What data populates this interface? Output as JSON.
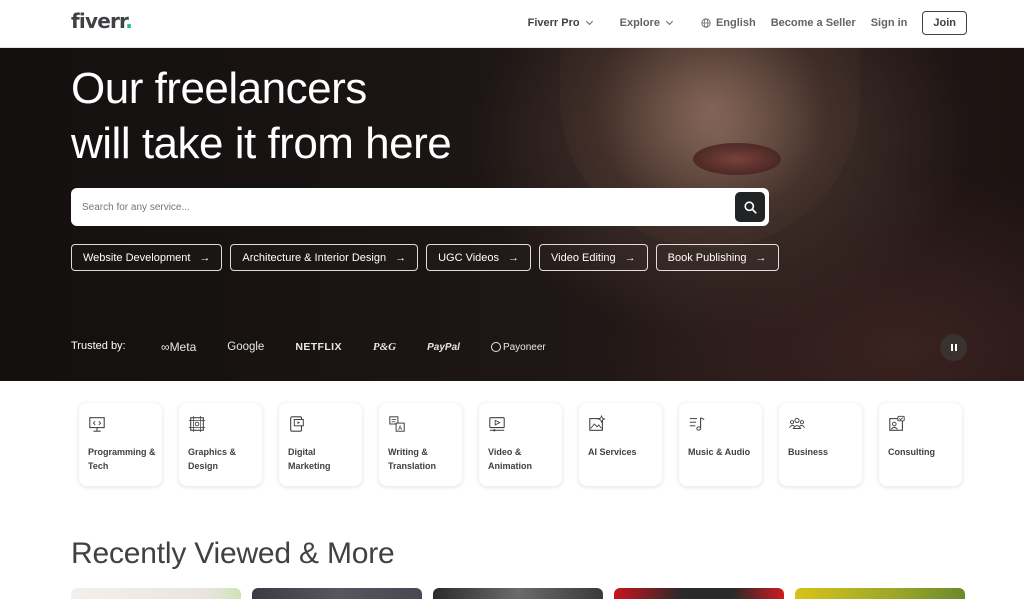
{
  "header": {
    "logo": "fiverr",
    "logo_dot": ".",
    "nav": {
      "fiverr_pro": "Fiverr Pro",
      "explore": "Explore",
      "language": "English",
      "become_seller": "Become a Seller",
      "sign_in": "Sign in",
      "join": "Join"
    }
  },
  "hero": {
    "title_line1": "Our freelancers",
    "title_line2": "will take it from here",
    "search": {
      "placeholder": "Search for any service...",
      "icon": "search-icon"
    },
    "chips": [
      {
        "label": "Website Development"
      },
      {
        "label": "Architecture & Interior Design"
      },
      {
        "label": "UGC Videos"
      },
      {
        "label": "Video Editing"
      },
      {
        "label": "Book Publishing"
      }
    ],
    "chip_arrow": "→",
    "trusted_by": "Trusted by:",
    "brands": [
      "Meta",
      "Google",
      "NETFLIX",
      "P&G",
      "PayPal",
      "Payoneer"
    ],
    "pause_icon": "pause-icon"
  },
  "categories": [
    {
      "label": "Programming & Tech",
      "icon": "code-screen-icon"
    },
    {
      "label": "Graphics & Design",
      "icon": "design-frame-icon"
    },
    {
      "label": "Digital Marketing",
      "icon": "marketing-icon"
    },
    {
      "label": "Writing & Translation",
      "icon": "translate-icon"
    },
    {
      "label": "Video & Animation",
      "icon": "video-play-icon"
    },
    {
      "label": "AI Services",
      "icon": "ai-image-icon"
    },
    {
      "label": "Music & Audio",
      "icon": "music-note-icon"
    },
    {
      "label": "Business",
      "icon": "people-icon"
    },
    {
      "label": "Consulting",
      "icon": "consulting-icon"
    }
  ],
  "recent": {
    "title": "Recently Viewed & More"
  },
  "colors": {
    "brand_green": "#1dbf73",
    "text_dark": "#404145",
    "hero_bg": "#141010"
  }
}
